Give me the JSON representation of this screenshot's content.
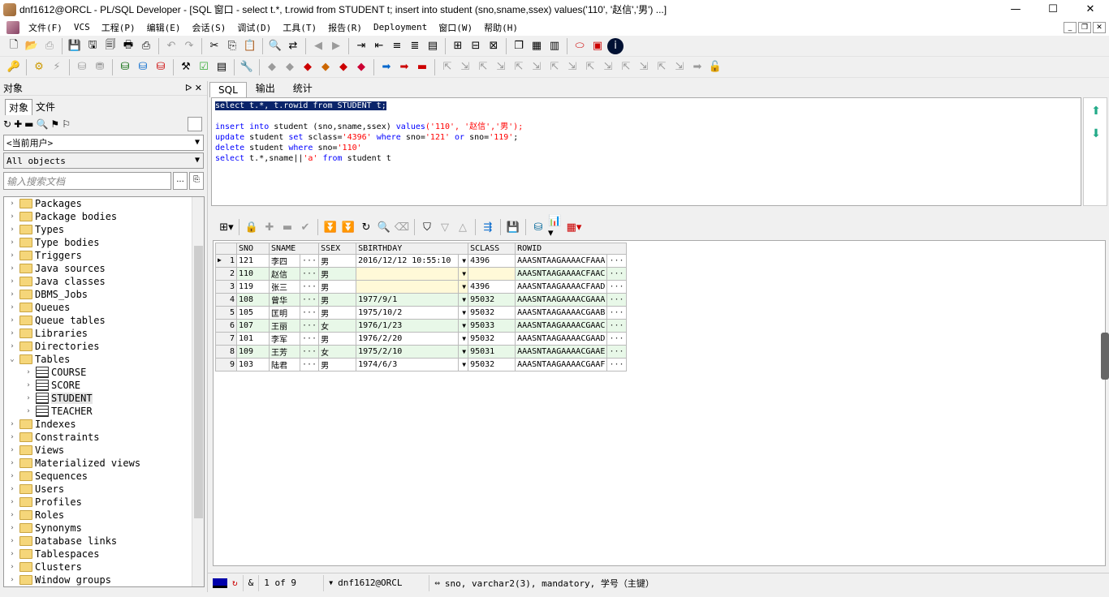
{
  "window": {
    "title": "dnf1612@ORCL - PL/SQL Developer - [SQL 窗口 - select t.*, t.rowid from STUDENT t; insert into student (sno,sname,ssex) values('110', '赵信','男') ...]",
    "minimize": "—",
    "maximize": "☐",
    "close": "✕"
  },
  "menu": [
    "文件(F)",
    "VCS",
    "工程(P)",
    "编辑(E)",
    "会话(S)",
    "调试(D)",
    "工具(T)",
    "报告(R)",
    "Deployment",
    "窗口(W)",
    "帮助(H)"
  ],
  "object_pane": {
    "header": "对象",
    "pin": "ᐅ ✕",
    "tabs": [
      "对象",
      "文件"
    ],
    "user_select": "<当前用户>",
    "type_select": "All objects",
    "search_placeholder": "输入搜索文档",
    "search_btn": "...",
    "tree": [
      {
        "label": "Packages",
        "expanded": false
      },
      {
        "label": "Package bodies",
        "expanded": false
      },
      {
        "label": "Types",
        "expanded": false
      },
      {
        "label": "Type bodies",
        "expanded": false
      },
      {
        "label": "Triggers",
        "expanded": false
      },
      {
        "label": "Java sources",
        "expanded": false
      },
      {
        "label": "Java classes",
        "expanded": false
      },
      {
        "label": "DBMS_Jobs",
        "expanded": false
      },
      {
        "label": "Queues",
        "expanded": false
      },
      {
        "label": "Queue tables",
        "expanded": false
      },
      {
        "label": "Libraries",
        "expanded": false
      },
      {
        "label": "Directories",
        "expanded": false
      },
      {
        "label": "Tables",
        "expanded": true
      },
      {
        "label": "COURSE",
        "child": true
      },
      {
        "label": "SCORE",
        "child": true
      },
      {
        "label": "STUDENT",
        "child": true,
        "selected": true
      },
      {
        "label": "TEACHER",
        "child": true
      },
      {
        "label": "Indexes",
        "expanded": false
      },
      {
        "label": "Constraints",
        "expanded": false
      },
      {
        "label": "Views",
        "expanded": false
      },
      {
        "label": "Materialized views",
        "expanded": false
      },
      {
        "label": "Sequences",
        "expanded": false
      },
      {
        "label": "Users",
        "expanded": false
      },
      {
        "label": "Profiles",
        "expanded": false
      },
      {
        "label": "Roles",
        "expanded": false
      },
      {
        "label": "Synonyms",
        "expanded": false
      },
      {
        "label": "Database links",
        "expanded": false
      },
      {
        "label": "Tablespaces",
        "expanded": false
      },
      {
        "label": "Clusters",
        "expanded": false
      },
      {
        "label": "Window groups",
        "expanded": false
      }
    ]
  },
  "sql_tabs": [
    "SQL",
    "输出",
    "统计"
  ],
  "editor": {
    "line1": "select t.*, t.rowid from STUDENT t;",
    "line3_a": "insert into",
    "line3_b": " student (sno,sname,ssex) ",
    "line3_c": "values",
    "line3_d": "('110', '赵信','男');",
    "line4_a": "update",
    "line4_b": " student ",
    "line4_c": "set",
    "line4_d": " sclass=",
    "line4_e": "'4396'",
    "line4_f": " where",
    "line4_g": " sno=",
    "line4_h": "'121'",
    "line4_i": " or",
    "line4_j": " sno=",
    "line4_k": "'119'",
    "line4_l": ";",
    "line5_a": "delete",
    "line5_b": " student ",
    "line5_c": "where",
    "line5_d": " sno=",
    "line5_e": "'110'",
    "line6_a": "select",
    "line6_b": " t.*,sname||",
    "line6_c": "'a'",
    "line6_d": " from",
    "line6_e": " student t"
  },
  "grid": {
    "columns": [
      "SNO",
      "SNAME",
      "SSEX",
      "SBIRTHDAY",
      "SCLASS",
      "ROWID"
    ],
    "rows": [
      {
        "n": "1",
        "sno": "121",
        "sname": "李四",
        "ssex": "男",
        "sbirthday": "2016/12/12 10:55:10",
        "sclass": "4396",
        "rowid": "AAASNTAAGAAAACFAAA"
      },
      {
        "n": "2",
        "sno": "110",
        "sname": "赵信",
        "ssex": "男",
        "sbirthday": "",
        "sclass": "",
        "rowid": "AAASNTAAGAAAACFAAC"
      },
      {
        "n": "3",
        "sno": "119",
        "sname": "张三",
        "ssex": "男",
        "sbirthday": "",
        "sclass": "4396",
        "rowid": "AAASNTAAGAAAACFAAD"
      },
      {
        "n": "4",
        "sno": "108",
        "sname": "曾华",
        "ssex": "男",
        "sbirthday": "1977/9/1",
        "sclass": "95032",
        "rowid": "AAASNTAAGAAAACGAAA"
      },
      {
        "n": "5",
        "sno": "105",
        "sname": "匡明",
        "ssex": "男",
        "sbirthday": "1975/10/2",
        "sclass": "95032",
        "rowid": "AAASNTAAGAAAACGAAB"
      },
      {
        "n": "6",
        "sno": "107",
        "sname": "王丽",
        "ssex": "女",
        "sbirthday": "1976/1/23",
        "sclass": "95033",
        "rowid": "AAASNTAAGAAAACGAAC"
      },
      {
        "n": "7",
        "sno": "101",
        "sname": "李军",
        "ssex": "男",
        "sbirthday": "1976/2/20",
        "sclass": "95032",
        "rowid": "AAASNTAAGAAAACGAAD"
      },
      {
        "n": "8",
        "sno": "109",
        "sname": "王芳",
        "ssex": "女",
        "sbirthday": "1975/2/10",
        "sclass": "95031",
        "rowid": "AAASNTAAGAAAACGAAE"
      },
      {
        "n": "9",
        "sno": "103",
        "sname": "陆君",
        "ssex": "男",
        "sbirthday": "1974/6/3",
        "sclass": "95032",
        "rowid": "AAASNTAAGAAAACGAAF"
      }
    ],
    "ellipsis": "···",
    "dropdown": "▼"
  },
  "status": {
    "amp": "&",
    "records": "1 of 9",
    "connection": "dnf1612@ORCL",
    "column_info": "sno, varchar2(3), mandatory, 学号（主键）"
  }
}
